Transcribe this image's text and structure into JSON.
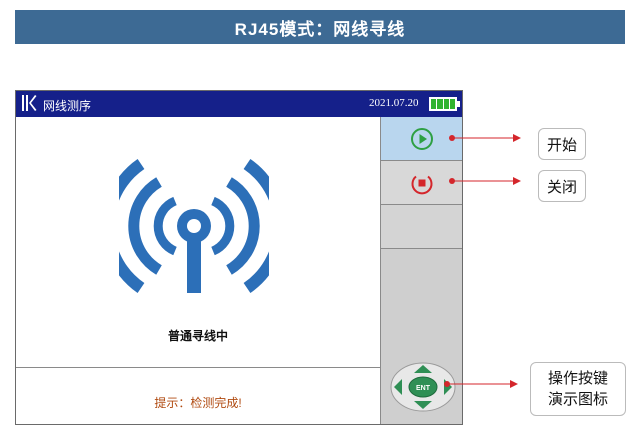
{
  "banner": {
    "title": "RJ45模式：网线寻线"
  },
  "device": {
    "app_title": "网线测序",
    "date": "2021.07.20",
    "battery_level": 1.0,
    "status_text": "普通寻线中",
    "hint_text": "提示：检测完成!",
    "side_buttons": [
      {
        "icon": "play-circle-icon",
        "color": "#2ea043"
      },
      {
        "icon": "stop-circle-icon",
        "color": "#d4262b"
      }
    ],
    "dpad": {
      "center_label": "ENT"
    }
  },
  "callouts": {
    "start": "开始",
    "close": "关闭",
    "demo_line1": "操作按键",
    "demo_line2": "演示图标"
  },
  "colors": {
    "banner": "#3d6a94",
    "titlebar": "#15208a",
    "signal_icon": "#2c6fb8",
    "arrow": "#d4262b"
  }
}
